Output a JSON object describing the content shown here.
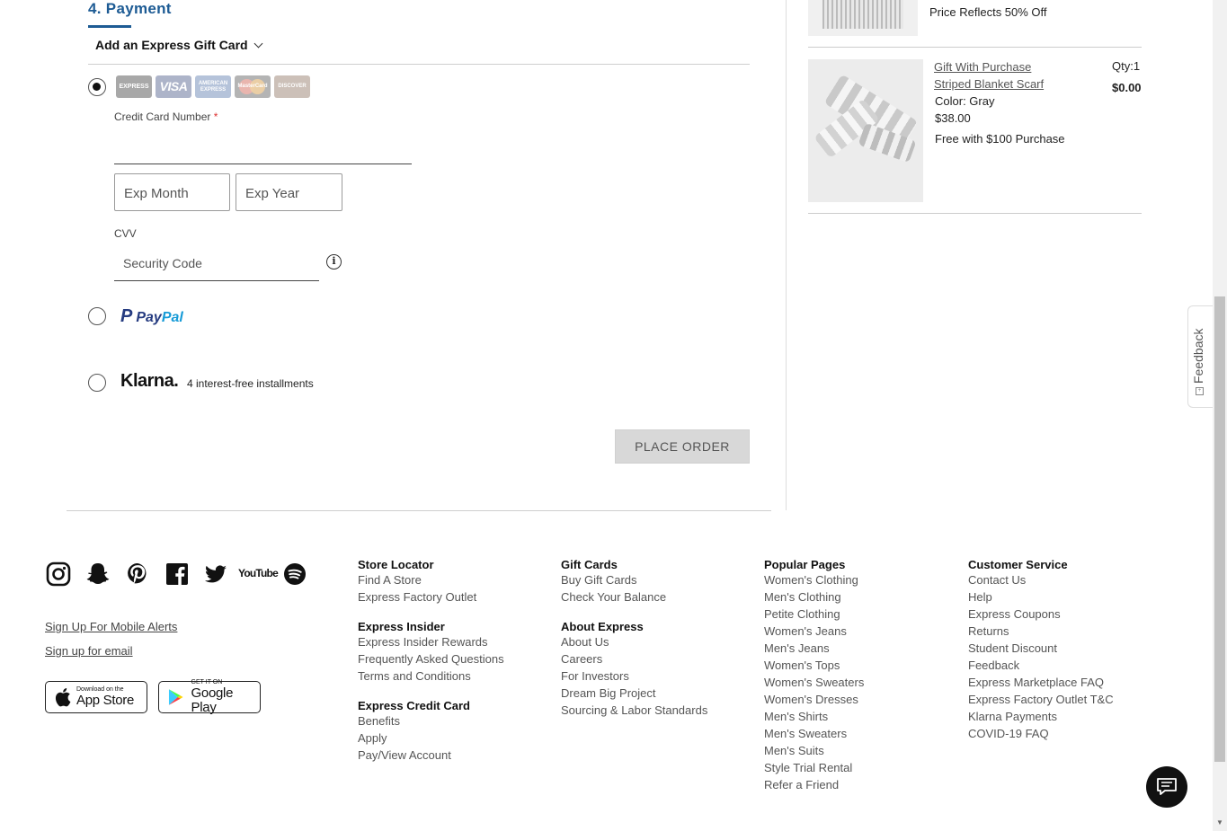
{
  "payment": {
    "title": "4. Payment",
    "gift_card_toggle": "Add an Express Gift Card",
    "cards": [
      "EXPRESS",
      "VISA",
      "AMERICAN EXPRESS",
      "MasterCard",
      "DISCOVER"
    ],
    "cc_label": "Credit Card Number",
    "required_mark": "*",
    "exp_month_placeholder": "Exp Month",
    "exp_year_placeholder": "Exp Year",
    "cvv_label": "CVV",
    "cvv_placeholder": "Security Code",
    "paypal_word1": "Pay",
    "paypal_word2": "Pal",
    "klarna_logo": "Klarna.",
    "klarna_text": "4 interest-free installments",
    "place_order": "PLACE ORDER",
    "selected_method": "credit-card"
  },
  "summary": {
    "item1_note": "Price Reflects 50% Off",
    "item2": {
      "link1": "Gift With Purchase",
      "link2": "Striped Blanket Scarf",
      "color": "Color: Gray",
      "price": "$38.00",
      "promo": "Free with $100 Purchase",
      "qty": "Qty:1",
      "total": "$0.00"
    }
  },
  "feedback_tab": "Feedback",
  "footer": {
    "social": [
      "instagram-icon",
      "snapchat-icon",
      "pinterest-icon",
      "facebook-icon",
      "twitter-icon",
      "youtube-icon",
      "spotify-icon"
    ],
    "youtube_label": "YouTube",
    "mobile_alerts": "Sign Up For Mobile Alerts",
    "email_signup": "Sign up for email",
    "appstore_small": "Download on the",
    "appstore_big": "App Store",
    "googleplay_small": "GET IT ON",
    "googleplay_big": "Google Play",
    "col1": {
      "h1": "Store Locator",
      "links1": [
        "Find A Store",
        "Express Factory Outlet"
      ],
      "h2": "Express Insider",
      "links2": [
        "Express Insider Rewards",
        "Frequently Asked Questions",
        "Terms and Conditions"
      ],
      "h3": "Express Credit Card",
      "links3": [
        "Benefits",
        "Apply",
        "Pay/View Account"
      ]
    },
    "col2": {
      "h1": "Gift Cards",
      "links1": [
        "Buy Gift Cards",
        "Check Your Balance"
      ],
      "h2": "About Express",
      "links2": [
        "About Us",
        "Careers",
        "For Investors",
        "Dream Big Project",
        "Sourcing & Labor Standards"
      ]
    },
    "col3": {
      "h1": "Popular Pages",
      "links1": [
        "Women's Clothing",
        "Men's Clothing",
        "Petite Clothing",
        "Women's Jeans",
        "Men's Jeans",
        "Women's Tops",
        "Women's Sweaters",
        "Women's Dresses",
        "Men's Shirts",
        "Men's Sweaters",
        "Men's Suits",
        "Style Trial Rental",
        "Refer a Friend"
      ]
    },
    "col4": {
      "h1": "Customer Service",
      "links1": [
        "Contact Us",
        "Help",
        "Express Coupons",
        "Returns",
        "Student Discount",
        "Feedback",
        "Express Marketplace FAQ",
        "Express Factory Outlet T&C",
        "Klarna Payments",
        "COVID-19 FAQ"
      ]
    }
  },
  "colors": {
    "accent": "#1d5b94",
    "button_disabled": "#d8d8d8",
    "paypal_dark": "#253b80",
    "paypal_light": "#179bd7"
  }
}
